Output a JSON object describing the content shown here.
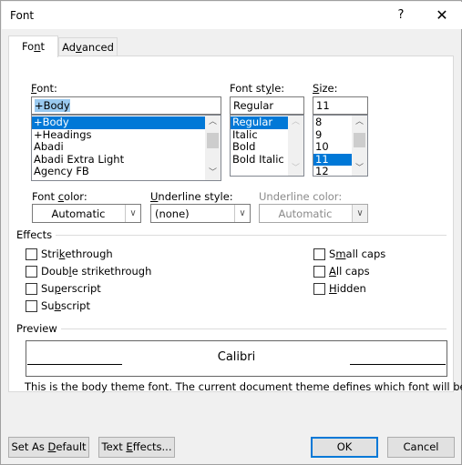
{
  "window": {
    "title": "Font",
    "help_label": "?",
    "close_label": "✕"
  },
  "tabs": [
    {
      "label_pre": "Fo",
      "label_u": "n",
      "label_post": "t",
      "active": true
    },
    {
      "label_pre": "Ad",
      "label_u": "v",
      "label_post": "anced",
      "active": false
    }
  ],
  "font": {
    "label_u": "F",
    "label_rest": "ont:",
    "value": "+Body",
    "items": [
      "+Body",
      "+Headings",
      "Abadi",
      "Abadi Extra Light",
      "Agency FB"
    ],
    "selected_index": 0
  },
  "font_style": {
    "label_pre": "Font st",
    "label_u": "y",
    "label_post": "le:",
    "value": "Regular",
    "items": [
      "Regular",
      "Italic",
      "Bold",
      "Bold Italic"
    ],
    "selected_index": 0
  },
  "size": {
    "label_u": "S",
    "label_rest": "ize:",
    "value": "11",
    "items": [
      "8",
      "9",
      "10",
      "11",
      "12"
    ],
    "selected_index": 3
  },
  "font_color": {
    "label_pre": "Font ",
    "label_u": "c",
    "label_post": "olor:",
    "value": "Automatic"
  },
  "underline_style": {
    "label_u": "U",
    "label_rest": "nderline style:",
    "value": "(none)"
  },
  "underline_color": {
    "label": "Underline color:",
    "value": "Automatic",
    "disabled": true
  },
  "effects": {
    "title": "Effects",
    "left": [
      {
        "pre": "Stri",
        "u": "k",
        "post": "ethrough",
        "checked": false
      },
      {
        "pre": "Doub",
        "u": "l",
        "post": "e strikethrough",
        "checked": false
      },
      {
        "pre": "Su",
        "u": "p",
        "post": "erscript",
        "checked": false
      },
      {
        "pre": "Su",
        "u": "b",
        "post": "script",
        "checked": false
      }
    ],
    "right": [
      {
        "pre": "S",
        "u": "m",
        "post": "all caps",
        "checked": false
      },
      {
        "pre": "",
        "u": "A",
        "post": "ll caps",
        "checked": false
      },
      {
        "pre": "",
        "u": "H",
        "post": "idden",
        "checked": false
      }
    ]
  },
  "preview": {
    "title": "Preview",
    "sample": "Calibri",
    "description": "This is the body theme font. The current document theme defines which font will be used."
  },
  "buttons": {
    "set_default": {
      "pre": "Set As ",
      "u": "D",
      "post": "efault"
    },
    "text_effects": {
      "pre": "Text ",
      "u": "E",
      "post": "ffects..."
    },
    "ok": "OK",
    "cancel": "Cancel"
  },
  "colors": {
    "selection": "#0078d7",
    "default_button_border": "#0078d7"
  }
}
